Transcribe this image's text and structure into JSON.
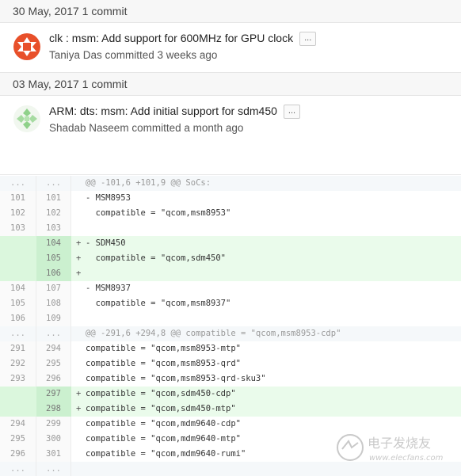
{
  "commit_groups": [
    {
      "date_label": "30 May, 2017 1 commit",
      "commit": {
        "title": "clk : msm: Add support for 600MHz for GPU clock",
        "ellipsis": "...",
        "meta": "Taniya Das committed 3 weeks ago",
        "avatar_color": "#e8502a"
      }
    },
    {
      "date_label": "03 May, 2017 1 commit",
      "commit": {
        "title": "ARM: dts: msm: Add initial support for sdm450",
        "ellipsis": "...",
        "meta": "Shadab Naseem committed a month ago",
        "avatar_color": "#8fd18a"
      }
    }
  ],
  "diff": {
    "rows": [
      {
        "type": "hunk",
        "old": "...",
        "new": "...",
        "marker": "",
        "text": "@@ -101,6 +101,9 @@ SoCs:"
      },
      {
        "type": "ctx",
        "old": "101",
        "new": "101",
        "marker": "",
        "text": "- MSM8953"
      },
      {
        "type": "ctx",
        "old": "102",
        "new": "102",
        "marker": "",
        "text": "  compatible = \"qcom,msm8953\""
      },
      {
        "type": "ctx",
        "old": "103",
        "new": "103",
        "marker": "",
        "text": ""
      },
      {
        "type": "add",
        "old": "",
        "new": "104",
        "marker": "+",
        "text": "- SDM450"
      },
      {
        "type": "add",
        "old": "",
        "new": "105",
        "marker": "+",
        "text": "  compatible = \"qcom,sdm450\""
      },
      {
        "type": "add",
        "old": "",
        "new": "106",
        "marker": "+",
        "text": ""
      },
      {
        "type": "ctx",
        "old": "104",
        "new": "107",
        "marker": "",
        "text": "- MSM8937"
      },
      {
        "type": "ctx",
        "old": "105",
        "new": "108",
        "marker": "",
        "text": "  compatible = \"qcom,msm8937\""
      },
      {
        "type": "ctx",
        "old": "106",
        "new": "109",
        "marker": "",
        "text": ""
      },
      {
        "type": "hunk",
        "old": "...",
        "new": "...",
        "marker": "",
        "text": "@@ -291,6 +294,8 @@ compatible = \"qcom,msm8953-cdp\""
      },
      {
        "type": "ctx",
        "old": "291",
        "new": "294",
        "marker": "",
        "text": "compatible = \"qcom,msm8953-mtp\""
      },
      {
        "type": "ctx",
        "old": "292",
        "new": "295",
        "marker": "",
        "text": "compatible = \"qcom,msm8953-qrd\""
      },
      {
        "type": "ctx",
        "old": "293",
        "new": "296",
        "marker": "",
        "text": "compatible = \"qcom,msm8953-qrd-sku3\""
      },
      {
        "type": "add",
        "old": "",
        "new": "297",
        "marker": "+",
        "text": "compatible = \"qcom,sdm450-cdp\""
      },
      {
        "type": "add",
        "old": "",
        "new": "298",
        "marker": "+",
        "text": "compatible = \"qcom,sdm450-mtp\""
      },
      {
        "type": "ctx",
        "old": "294",
        "new": "299",
        "marker": "",
        "text": "compatible = \"qcom,mdm9640-cdp\""
      },
      {
        "type": "ctx",
        "old": "295",
        "new": "300",
        "marker": "",
        "text": "compatible = \"qcom,mdm9640-mtp\""
      },
      {
        "type": "ctx",
        "old": "296",
        "new": "301",
        "marker": "",
        "text": "compatible = \"qcom,mdm9640-rumi\""
      },
      {
        "type": "hunk",
        "old": "...",
        "new": "...",
        "marker": "",
        "text": ""
      }
    ]
  },
  "watermark": {
    "cn": "电子发烧友",
    "url": "www.elecfans.com"
  }
}
